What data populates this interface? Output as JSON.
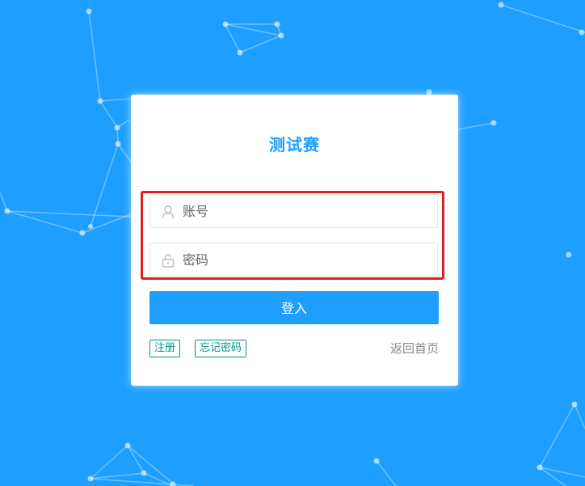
{
  "page": {
    "title": "测试赛"
  },
  "form": {
    "account_placeholder": "账号",
    "password_placeholder": "密码",
    "login_label": "登入"
  },
  "links": {
    "register": "注册",
    "forgot_password": "忘记密码",
    "back_home": "返回首页"
  },
  "icons": {
    "account": "user-icon",
    "password": "lock-icon"
  },
  "colors": {
    "background": "#1e9fff",
    "accent": "#1e9fff",
    "link_tag": "#009688",
    "highlight": "#e02020"
  }
}
